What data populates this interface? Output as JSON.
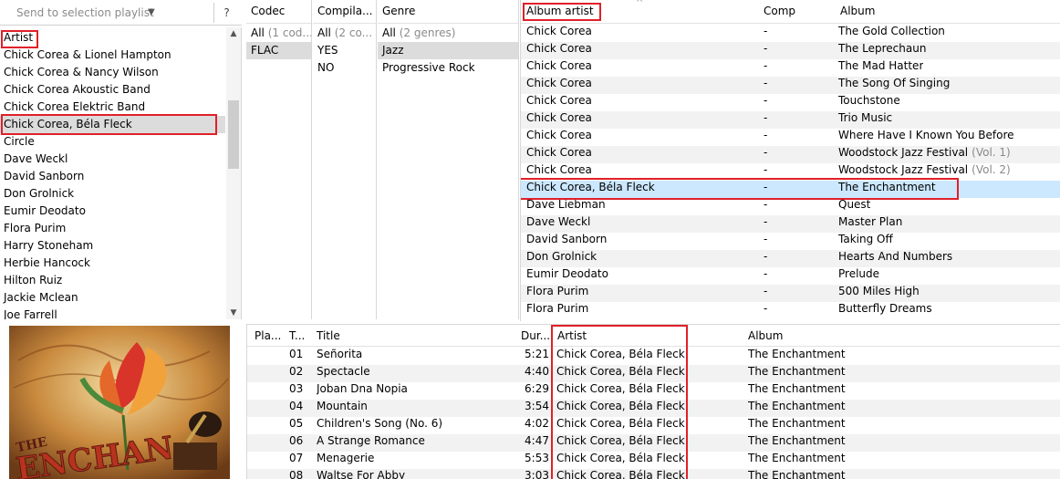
{
  "toolbar": {
    "send_placeholder": "Send to selection playlist",
    "help": "?"
  },
  "artist_list": {
    "header": "Artist",
    "items": [
      "Chick Corea & Lionel Hampton",
      "Chick Corea & Nancy Wilson",
      "Chick Corea Akoustic Band",
      "Chick Corea Elektric Band",
      "Chick Corea, Béla Fleck",
      "Circle",
      "Dave Weckl",
      "David Sanborn",
      "Don Grolnick",
      "Eumir Deodato",
      "Flora Purim",
      "Harry Stoneham",
      "Herbie Hancock",
      "Hilton Ruiz",
      "Jackie Mclean",
      "Joe Farrell"
    ],
    "selected": "Chick Corea, Béla Fleck"
  },
  "filters": {
    "codec": {
      "header": "Codec",
      "all_label": "All",
      "all_note": "(1 cod...",
      "items": [
        "FLAC"
      ]
    },
    "compilation": {
      "header": "Compila...",
      "all_label": "All",
      "all_note": "(2 co...",
      "items": [
        "YES",
        "NO"
      ]
    },
    "genre": {
      "header": "Genre",
      "all_label": "All",
      "all_note": "(2 genres)",
      "items": [
        "Jazz",
        "Progressive Rock"
      ]
    }
  },
  "album_list": {
    "columns": {
      "album_artist": "Album artist",
      "comp": "Comp",
      "album": "Album"
    },
    "rows": [
      {
        "artist": "Chick Corea",
        "comp": "-",
        "album": "The Gold Collection",
        "note": ""
      },
      {
        "artist": "Chick Corea",
        "comp": "-",
        "album": "The Leprechaun",
        "note": ""
      },
      {
        "artist": "Chick Corea",
        "comp": "-",
        "album": "The Mad Hatter",
        "note": ""
      },
      {
        "artist": "Chick Corea",
        "comp": "-",
        "album": "The Song Of Singing",
        "note": ""
      },
      {
        "artist": "Chick Corea",
        "comp": "-",
        "album": "Touchstone",
        "note": ""
      },
      {
        "artist": "Chick Corea",
        "comp": "-",
        "album": "Trio Music",
        "note": ""
      },
      {
        "artist": "Chick Corea",
        "comp": "-",
        "album": "Where Have I Known You Before",
        "note": ""
      },
      {
        "artist": "Chick Corea",
        "comp": "-",
        "album": "Woodstock Jazz Festival",
        "note": "(Vol. 1)"
      },
      {
        "artist": "Chick Corea",
        "comp": "-",
        "album": "Woodstock Jazz Festival",
        "note": "(Vol. 2)"
      },
      {
        "artist": "Chick Corea, Béla Fleck",
        "comp": "-",
        "album": "The Enchantment",
        "note": ""
      },
      {
        "artist": "Dave Liebman",
        "comp": "-",
        "album": "Quest",
        "note": ""
      },
      {
        "artist": "Dave Weckl",
        "comp": "-",
        "album": "Master Plan",
        "note": ""
      },
      {
        "artist": "David Sanborn",
        "comp": "-",
        "album": "Taking Off",
        "note": ""
      },
      {
        "artist": "Don Grolnick",
        "comp": "-",
        "album": "Hearts And Numbers",
        "note": ""
      },
      {
        "artist": "Eumir Deodato",
        "comp": "-",
        "album": "Prelude",
        "note": ""
      },
      {
        "artist": "Flora Purim",
        "comp": "-",
        "album": "500 Miles High",
        "note": ""
      },
      {
        "artist": "Flora Purim",
        "comp": "-",
        "album": "Butterfly Dreams",
        "note": ""
      }
    ]
  },
  "album_art": {
    "title_text": "THE ENCHANT"
  },
  "track_list": {
    "columns": {
      "playing": "Pla...",
      "track": "T...",
      "title": "Title",
      "duration": "Dur...",
      "artist": "Artist",
      "album": "Album"
    },
    "rows": [
      {
        "no": "01",
        "title": "Señorita",
        "dur": "5:21",
        "artist": "Chick Corea, Béla Fleck",
        "album": "The Enchantment"
      },
      {
        "no": "02",
        "title": "Spectacle",
        "dur": "4:40",
        "artist": "Chick Corea, Béla Fleck",
        "album": "The Enchantment"
      },
      {
        "no": "03",
        "title": "Joban Dna Nopia",
        "dur": "6:29",
        "artist": "Chick Corea, Béla Fleck",
        "album": "The Enchantment"
      },
      {
        "no": "04",
        "title": "Mountain",
        "dur": "3:54",
        "artist": "Chick Corea, Béla Fleck",
        "album": "The Enchantment"
      },
      {
        "no": "05",
        "title": "Children's Song (No. 6)",
        "dur": "4:02",
        "artist": "Chick Corea, Béla Fleck",
        "album": "The Enchantment"
      },
      {
        "no": "06",
        "title": "A Strange Romance",
        "dur": "4:47",
        "artist": "Chick Corea, Béla Fleck",
        "album": "The Enchantment"
      },
      {
        "no": "07",
        "title": "Menagerie",
        "dur": "5:53",
        "artist": "Chick Corea, Béla Fleck",
        "album": "The Enchantment"
      },
      {
        "no": "08",
        "title": "Waltse For Abby",
        "dur": "3:03",
        "artist": "Chick Corea, Béla Fleck",
        "album": "The Enchantment"
      }
    ]
  },
  "colors": {
    "highlight_box": "#e0202a",
    "selected_row": "#cce8ff",
    "selected_gray": "#dcdcdc"
  }
}
